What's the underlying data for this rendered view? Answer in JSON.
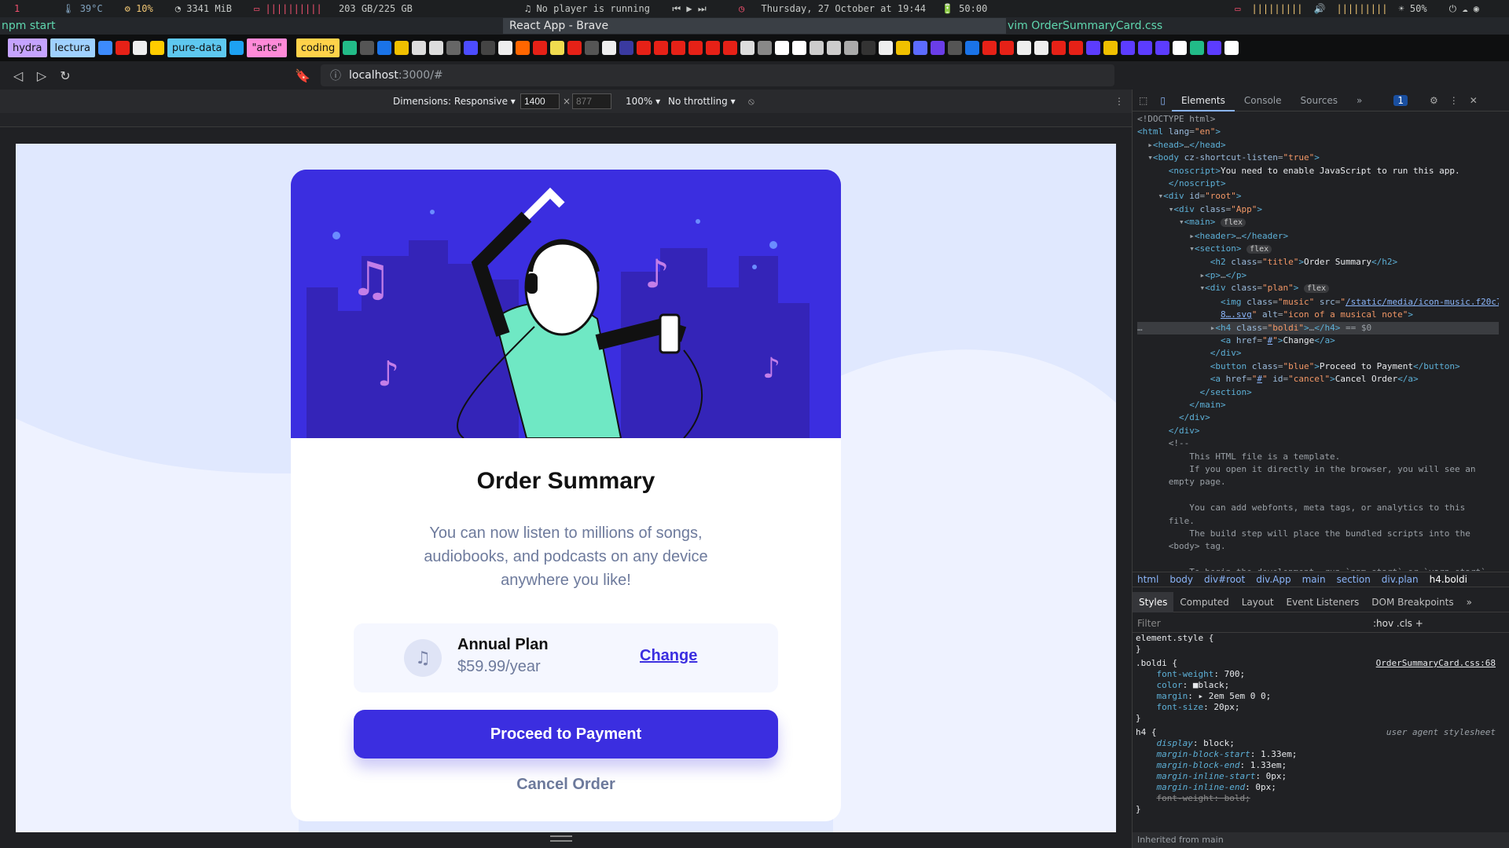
{
  "sysbar": {
    "workspace": "1",
    "temp": "39°C",
    "cpu": "10%",
    "mem": "3341 MiB",
    "disk": "203 GB/225 GB",
    "player": "No player is running",
    "datetime": "Thursday, 27 October at 19:44",
    "battery": "50:00",
    "brightness": "50%"
  },
  "titlerow": {
    "left": "npm start",
    "center": "React App - Brave",
    "right": "vim OrderSummaryCard.css"
  },
  "bookmarks": [
    "hydra",
    "lectura",
    "pure-data",
    "\"arte\"",
    "coding"
  ],
  "nav": {
    "url_host": "localhost",
    "url_path": ":3000/#"
  },
  "devbar": {
    "dimensions": "Dimensions: Responsive ▾",
    "width": "1400",
    "height_placeholder": "877",
    "zoom": "100% ▾",
    "throttle": "No throttling ▾"
  },
  "page": {
    "title": "Order Summary",
    "description": "You can now listen to millions of songs, audiobooks, and podcasts on any device anywhere you like!",
    "plan_name": "Annual Plan",
    "plan_price": "$59.99/year",
    "change_label": "Change",
    "pay_label": "Proceed to Payment",
    "cancel_label": "Cancel Order",
    "colors": {
      "accent": "#3b2ee0",
      "hero_bg": "#3b2ee0",
      "page_bg": "#e0e8fe",
      "muted": "#6d7a9c"
    }
  },
  "devtools": {
    "tabs": [
      "Elements",
      "Console",
      "Sources",
      "»"
    ],
    "issues": "1",
    "breadcrumbs": [
      "html",
      "body",
      "div#root",
      "div.App",
      "main",
      "section",
      "div.plan",
      "h4.boldi"
    ],
    "style_tabs": [
      "Styles",
      "Computed",
      "Layout",
      "Event Listeners",
      "DOM Breakpoints",
      "»"
    ],
    "filter_placeholder": "Filter",
    "filter_tools": ":hov  .cls  +",
    "inherited": "Inherited from main",
    "source_file": "OrderSummaryCard.css:68",
    "ua_label": "user agent stylesheet"
  }
}
